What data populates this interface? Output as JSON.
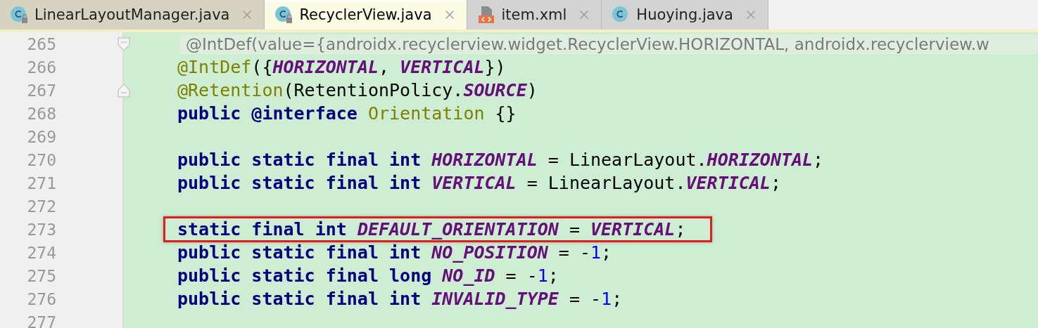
{
  "tabs": [
    {
      "label": "LinearLayoutManager.java",
      "kind": "class",
      "locked": true,
      "selected": false,
      "color": "#d6d3c2"
    },
    {
      "label": "RecyclerView.java",
      "kind": "class",
      "locked": true,
      "selected": true,
      "color": "#fcfbe4"
    },
    {
      "label": "item.xml",
      "kind": "xml",
      "selected": false,
      "color": "#d3d3d3"
    },
    {
      "label": "Huoying.java",
      "kind": "class",
      "selected": false,
      "color": "#d3d3d3"
    }
  ],
  "editor": {
    "lines": [
      {
        "number": "265",
        "kind": "hint",
        "fold_start": true,
        "tokens": [
          {
            "text": "@IntDef(value={androidx.recyclerview.widget.RecyclerView.HORIZONTAL, androidx.recyclerview.w",
            "kind": "hint"
          }
        ]
      },
      {
        "number": "266",
        "kind": "code",
        "tokens": [
          {
            "text": "@IntDef",
            "kind": "annotation"
          },
          {
            "text": "({",
            "kind": "plain"
          },
          {
            "text": "HORIZONTAL",
            "kind": "constant"
          },
          {
            "text": ", ",
            "kind": "plain"
          },
          {
            "text": "VERTICAL",
            "kind": "constant"
          },
          {
            "text": "})",
            "kind": "plain"
          }
        ]
      },
      {
        "number": "267",
        "kind": "code",
        "fold_end": true,
        "tokens": [
          {
            "text": "@Retention",
            "kind": "annotation"
          },
          {
            "text": "(RetentionPolicy.",
            "kind": "plain"
          },
          {
            "text": "SOURCE",
            "kind": "constant"
          },
          {
            "text": ")",
            "kind": "plain"
          }
        ]
      },
      {
        "number": "268",
        "kind": "code",
        "tokens": [
          {
            "text": "public @interface ",
            "kind": "keyword"
          },
          {
            "text": "Orientation",
            "kind": "annotation"
          },
          {
            "text": " {}",
            "kind": "plain"
          }
        ]
      },
      {
        "number": "269",
        "kind": "code"
      },
      {
        "number": "270",
        "kind": "code",
        "tokens": [
          {
            "text": "public static final int ",
            "kind": "keyword"
          },
          {
            "text": "HORIZONTAL",
            "kind": "constant"
          },
          {
            "text": " = LinearLayout.",
            "kind": "plain"
          },
          {
            "text": "HORIZONTAL",
            "kind": "constant"
          },
          {
            "text": ";",
            "kind": "plain"
          }
        ]
      },
      {
        "number": "271",
        "kind": "code",
        "tokens": [
          {
            "text": "public static final int ",
            "kind": "keyword"
          },
          {
            "text": "VERTICAL",
            "kind": "constant"
          },
          {
            "text": " = LinearLayout.",
            "kind": "plain"
          },
          {
            "text": "VERTICAL",
            "kind": "constant"
          },
          {
            "text": ";",
            "kind": "plain"
          }
        ]
      },
      {
        "number": "272",
        "kind": "code"
      },
      {
        "number": "273",
        "kind": "code",
        "boxed": true,
        "tokens": [
          {
            "text": "static final int ",
            "kind": "keyword"
          },
          {
            "text": "DEFAULT_ORIENTATION",
            "kind": "constant"
          },
          {
            "text": " = ",
            "kind": "plain"
          },
          {
            "text": "VERTICAL",
            "kind": "constant"
          },
          {
            "text": ";",
            "kind": "plain"
          }
        ]
      },
      {
        "number": "274",
        "kind": "code",
        "tokens": [
          {
            "text": "public static final int ",
            "kind": "keyword"
          },
          {
            "text": "NO_POSITION",
            "kind": "constant"
          },
          {
            "text": " = -",
            "kind": "plain"
          },
          {
            "text": "1",
            "kind": "number"
          },
          {
            "text": ";",
            "kind": "plain"
          }
        ]
      },
      {
        "number": "275",
        "kind": "code",
        "tokens": [
          {
            "text": "public static final long ",
            "kind": "keyword"
          },
          {
            "text": "NO_ID",
            "kind": "constant"
          },
          {
            "text": " = -",
            "kind": "plain"
          },
          {
            "text": "1",
            "kind": "number"
          },
          {
            "text": ";",
            "kind": "plain"
          }
        ]
      },
      {
        "number": "276",
        "kind": "code",
        "tokens": [
          {
            "text": "public static final int ",
            "kind": "keyword"
          },
          {
            "text": "INVALID_TYPE",
            "kind": "constant"
          },
          {
            "text": " = -",
            "kind": "plain"
          },
          {
            "text": "1",
            "kind": "number"
          },
          {
            "text": ";",
            "kind": "plain"
          }
        ]
      },
      {
        "number": "277",
        "kind": "code"
      }
    ]
  }
}
